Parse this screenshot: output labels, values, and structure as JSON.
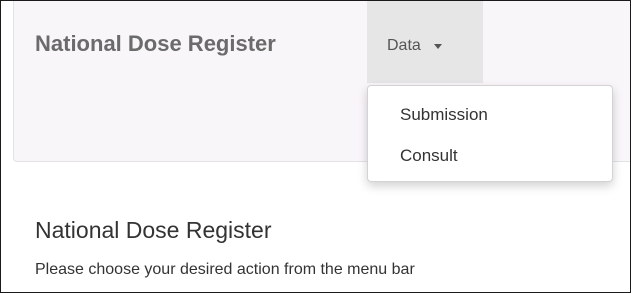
{
  "navbar": {
    "brand": "National Dose Register",
    "dropdown": {
      "label": "Data",
      "caret_icon": "caret-down-icon",
      "expanded": true,
      "items": [
        {
          "label": "Submission"
        },
        {
          "label": "Consult"
        }
      ]
    }
  },
  "main": {
    "title": "National Dose Register",
    "instruction": "Please choose your desired action from the menu bar"
  },
  "colors": {
    "navbar_bg": "#f9f6fa",
    "active_toggle_bg": "#e6e6e6",
    "brand_text": "#6b6b6b",
    "body_text": "#333333"
  }
}
